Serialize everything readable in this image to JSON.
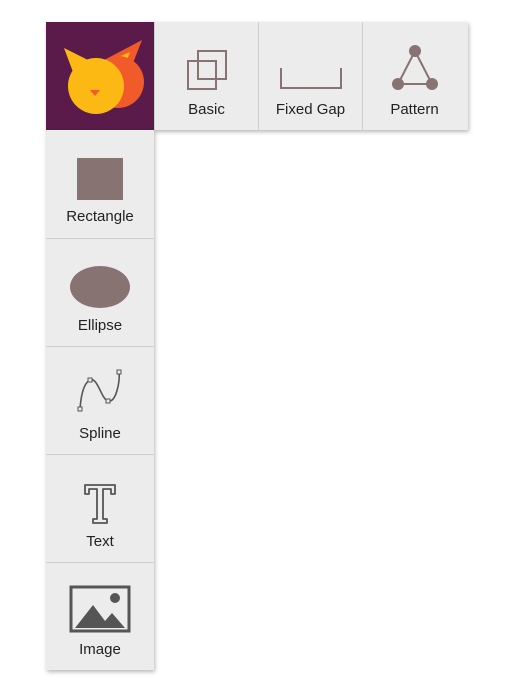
{
  "logo": {
    "icon": "cat-face-logo",
    "colors": {
      "background": "#5a1a4a",
      "ears": "#f15a29",
      "face": "#fdb913"
    }
  },
  "top_toolbar": {
    "items": [
      {
        "name": "basic",
        "label": "Basic",
        "icon": "overlapping-squares-icon"
      },
      {
        "name": "fixed-gap",
        "label": "Fixed Gap",
        "icon": "bracket-gap-icon"
      },
      {
        "name": "pattern",
        "label": "Pattern",
        "icon": "triangle-nodes-icon"
      }
    ]
  },
  "left_toolbar": {
    "items": [
      {
        "name": "rectangle",
        "label": "Rectangle",
        "icon": "rectangle-icon"
      },
      {
        "name": "ellipse",
        "label": "Ellipse",
        "icon": "ellipse-icon"
      },
      {
        "name": "spline",
        "label": "Spline",
        "icon": "spline-icon"
      },
      {
        "name": "text",
        "label": "Text",
        "icon": "text-icon"
      },
      {
        "name": "image",
        "label": "Image",
        "icon": "image-icon"
      }
    ]
  },
  "colors": {
    "shape_fill": "#877372",
    "icon_stroke": "#555555",
    "panel_bg": "#ececec"
  }
}
